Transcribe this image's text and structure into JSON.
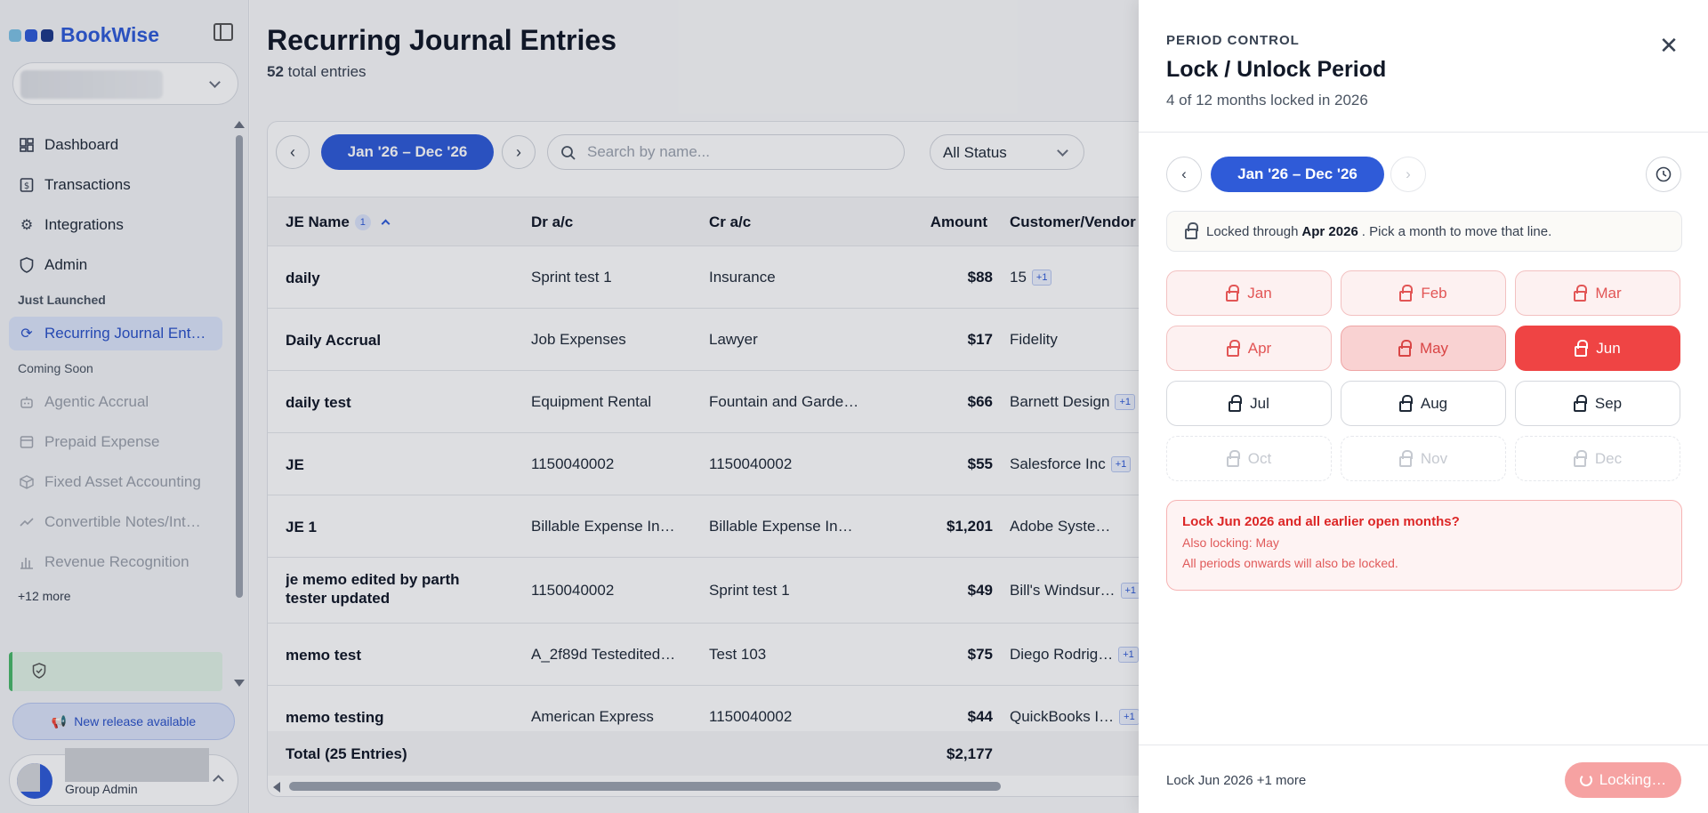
{
  "app": {
    "name": "BookWise",
    "brand_color": "#2f5bd8"
  },
  "sidebar": {
    "nav": [
      {
        "label": "Dashboard",
        "icon": "grid-icon"
      },
      {
        "label": "Transactions",
        "icon": "dollar-doc-icon"
      },
      {
        "label": "Integrations",
        "icon": "gear-icon"
      },
      {
        "label": "Admin",
        "icon": "shield-icon"
      }
    ],
    "section_launched": "Just Launched",
    "launched": [
      {
        "label": "Recurring Journal Ent…",
        "icon": "refresh-icon"
      }
    ],
    "section_soon": "Coming Soon",
    "soon": [
      {
        "label": "Agentic Accrual",
        "icon": "robot-icon"
      },
      {
        "label": "Prepaid Expense",
        "icon": "card-icon"
      },
      {
        "label": "Fixed Asset Accounting",
        "icon": "box-icon"
      },
      {
        "label": "Convertible Notes/Int…",
        "icon": "trend-icon"
      },
      {
        "label": "Revenue Recognition",
        "icon": "bar-chart-icon"
      }
    ],
    "more": "+12 more",
    "release_label": "New release available",
    "user_role": "Group Admin"
  },
  "main": {
    "title": "Recurring Journal Entries",
    "total_count": "52",
    "total_suffix": "total entries",
    "date_range": "Jan '26 – Dec '26",
    "search_placeholder": "Search by name...",
    "status_filter": "All Status",
    "columns": {
      "name": "JE Name",
      "sort_badge": "1",
      "dr": "Dr a/c",
      "cr": "Cr a/c",
      "amount": "Amount",
      "customer": "Customer/Vendor"
    },
    "rows": [
      {
        "name": "daily",
        "dr": "Sprint test 1",
        "cr": "Insurance",
        "amount": "$88",
        "customer": "15",
        "extra": "+1"
      },
      {
        "name": "Daily Accrual",
        "dr": "Job Expenses",
        "cr": "Lawyer",
        "amount": "$17",
        "customer": "Fidelity",
        "extra": ""
      },
      {
        "name": "daily test",
        "dr": "Equipment Rental",
        "cr": "Fountain and Garde…",
        "amount": "$66",
        "customer": "Barnett Design",
        "extra": "+1"
      },
      {
        "name": "JE",
        "dr": "1150040002",
        "cr": "1150040002",
        "amount": "$55",
        "customer": "Salesforce Inc",
        "extra": "+1"
      },
      {
        "name": "JE 1",
        "dr": "Billable Expense In…",
        "cr": "Billable Expense In…",
        "amount": "$1,201",
        "customer": "Adobe Syste…",
        "extra": ""
      },
      {
        "name": "je memo edited by parth tester updated",
        "dr": "1150040002",
        "cr": "Sprint test 1",
        "amount": "$49",
        "customer": "Bill's Windsur…",
        "extra": "+1"
      },
      {
        "name": "memo test",
        "dr": "A_2f89d Testedited…",
        "cr": "Test 103",
        "amount": "$75",
        "customer": "Diego Rodrig…",
        "extra": "+1"
      },
      {
        "name": "memo testing",
        "dr": "American Express",
        "cr": "1150040002",
        "amount": "$44",
        "customer": "QuickBooks I…",
        "extra": "+1"
      }
    ],
    "total_label": "Total (25 Entries)",
    "total_amount": "$2,177"
  },
  "panel": {
    "eyebrow": "PERIOD CONTROL",
    "title": "Lock / Unlock Period",
    "subtitle": "4 of 12 months locked in 2026",
    "date_range": "Jan '26 – Dec '26",
    "locked_prefix": "Locked through",
    "locked_month": "Apr 2026",
    "locked_suffix": ". Pick a month to move that line.",
    "months": [
      {
        "label": "Jan",
        "state": "locked"
      },
      {
        "label": "Feb",
        "state": "locked"
      },
      {
        "label": "Mar",
        "state": "locked"
      },
      {
        "label": "Apr",
        "state": "locked"
      },
      {
        "label": "May",
        "state": "selected-mid"
      },
      {
        "label": "Jun",
        "state": "selected-end"
      },
      {
        "label": "Jul",
        "state": "open"
      },
      {
        "label": "Aug",
        "state": "open"
      },
      {
        "label": "Sep",
        "state": "open"
      },
      {
        "label": "Oct",
        "state": "future"
      },
      {
        "label": "Nov",
        "state": "future"
      },
      {
        "label": "Dec",
        "state": "future"
      }
    ],
    "warning_title": "Lock Jun 2026 and all earlier open months?",
    "warning_line1": "Also locking: May",
    "warning_line2": "All periods onwards will also be locked.",
    "footer_note": "Lock Jun 2026 +1 more",
    "action_label": "Locking…",
    "colors": {
      "locked_text": "#e25555",
      "selected": "#ef4444",
      "warning_border": "#f6b3b3"
    }
  }
}
